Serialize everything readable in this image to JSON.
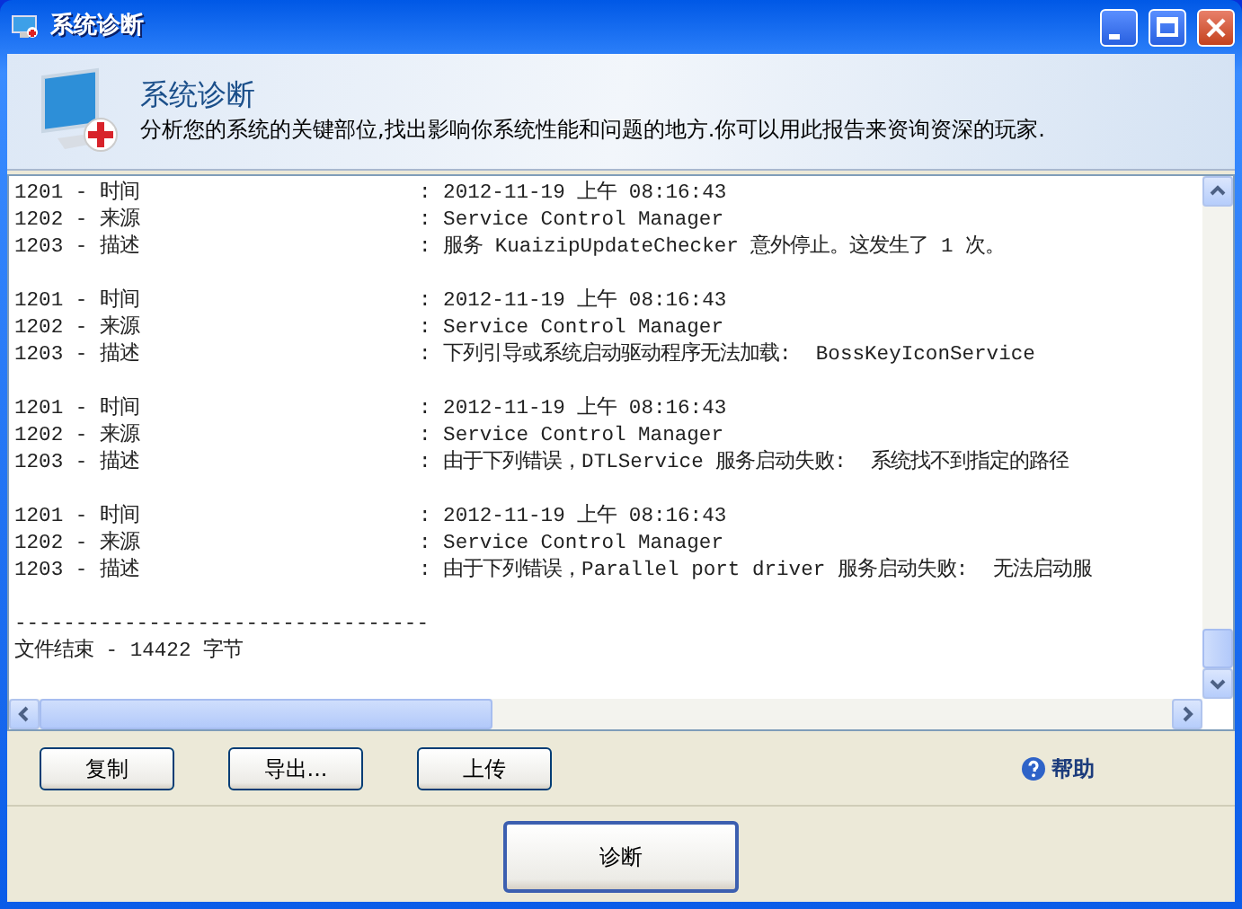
{
  "window": {
    "title": "系统诊断"
  },
  "header": {
    "title": "系统诊断",
    "description": "分析您的系统的关键部位,找出影响你系统性能和问题的地方.你可以用此报告来资询资深的玩家."
  },
  "log": {
    "entries": [
      {
        "lines": [
          {
            "label": "1201 - 时间",
            "value": ": 2012-11-19 上午 08:16:43"
          },
          {
            "label": "1202 - 来源",
            "value": ": Service Control Manager"
          },
          {
            "label": "1203 - 描述",
            "value": ": 服务 KuaizipUpdateChecker 意外停止。这发生了 1 次。"
          }
        ]
      },
      {
        "lines": [
          {
            "label": "1201 - 时间",
            "value": ": 2012-11-19 上午 08:16:43"
          },
          {
            "label": "1202 - 来源",
            "value": ": Service Control Manager"
          },
          {
            "label": "1203 - 描述",
            "value": ": 下列引导或系统启动驱动程序无法加载:  BossKeyIconService"
          }
        ]
      },
      {
        "lines": [
          {
            "label": "1201 - 时间",
            "value": ": 2012-11-19 上午 08:16:43"
          },
          {
            "label": "1202 - 来源",
            "value": ": Service Control Manager"
          },
          {
            "label": "1203 - 描述",
            "value": ": 由于下列错误，DTLService 服务启动失败:  系统找不到指定的路径"
          }
        ]
      },
      {
        "lines": [
          {
            "label": "1201 - 时间",
            "value": ": 2012-11-19 上午 08:16:43"
          },
          {
            "label": "1202 - 来源",
            "value": ": Service Control Manager"
          },
          {
            "label": "1203 - 描述",
            "value": ": 由于下列错误，Parallel port driver 服务启动失败:  无法启动服"
          }
        ]
      }
    ],
    "separator": "----------------------------------",
    "footer": "文件结束 - 14422 字节"
  },
  "buttons": [
    "复制",
    "导出...",
    "上传"
  ],
  "help_link": "帮助",
  "primary_button": "诊断"
}
